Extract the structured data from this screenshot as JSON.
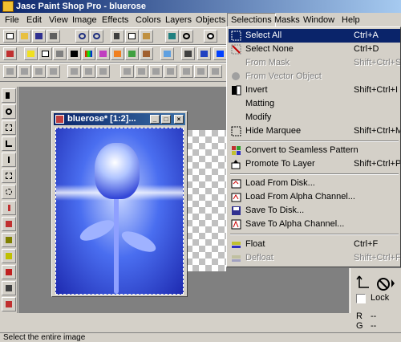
{
  "window": {
    "title": "Jasc Paint Shop Pro - bluerose"
  },
  "menubar": {
    "items": [
      "File",
      "Edit",
      "View",
      "Image",
      "Effects",
      "Colors",
      "Layers",
      "Objects",
      "Selections",
      "Masks",
      "Window",
      "Help"
    ]
  },
  "selections_menu": {
    "items": [
      {
        "label": "Select All",
        "shortcut": "Ctrl+A",
        "enabled": true,
        "highlighted": true,
        "icon": "select-all-icon"
      },
      {
        "label": "Select None",
        "shortcut": "Ctrl+D",
        "enabled": true,
        "icon": "select-none-icon"
      },
      {
        "label": "From Mask",
        "shortcut": "Shift+Ctrl+S",
        "enabled": false,
        "icon": ""
      },
      {
        "label": "From Vector Object",
        "shortcut": "",
        "enabled": false,
        "icon": "vector-object-icon"
      },
      {
        "label": "Invert",
        "shortcut": "Shift+Ctrl+I",
        "enabled": true,
        "icon": "invert-icon"
      },
      {
        "label": "Matting",
        "shortcut": "",
        "enabled": true,
        "icon": ""
      },
      {
        "label": "Modify",
        "shortcut": "",
        "enabled": true,
        "icon": ""
      },
      {
        "label": "Hide Marquee",
        "shortcut": "Shift+Ctrl+M",
        "enabled": true,
        "icon": "hide-marquee-icon"
      },
      {
        "label": "Convert to Seamless Pattern",
        "shortcut": "",
        "enabled": true,
        "icon": "seamless-pattern-icon"
      },
      {
        "label": "Promote To Layer",
        "shortcut": "Shift+Ctrl+P",
        "enabled": true,
        "icon": "promote-layer-icon"
      },
      {
        "label": "Load From Disk...",
        "shortcut": "",
        "enabled": true,
        "icon": "load-disk-icon"
      },
      {
        "label": "Load From Alpha Channel...",
        "shortcut": "",
        "enabled": true,
        "icon": "load-alpha-icon"
      },
      {
        "label": "Save To Disk...",
        "shortcut": "",
        "enabled": true,
        "icon": "save-disk-icon"
      },
      {
        "label": "Save To Alpha Channel...",
        "shortcut": "",
        "enabled": true,
        "icon": "save-alpha-icon"
      },
      {
        "label": "Float",
        "shortcut": "Ctrl+F",
        "enabled": true,
        "icon": "float-icon"
      },
      {
        "label": "Defloat",
        "shortcut": "Shift+Ctrl+F",
        "enabled": false,
        "icon": "defloat-icon"
      }
    ]
  },
  "image_window": {
    "title": "bluerose* [1:2]..."
  },
  "right_panel": {
    "lock_label": "Lock",
    "r_label": "R",
    "r_value": "--",
    "g_label": "G",
    "g_value": "--"
  },
  "status": {
    "text": "Select the entire image"
  },
  "colors": {
    "highlight": "#0a246a",
    "titlebar": "#0a246a",
    "face": "#d4d0c8"
  }
}
